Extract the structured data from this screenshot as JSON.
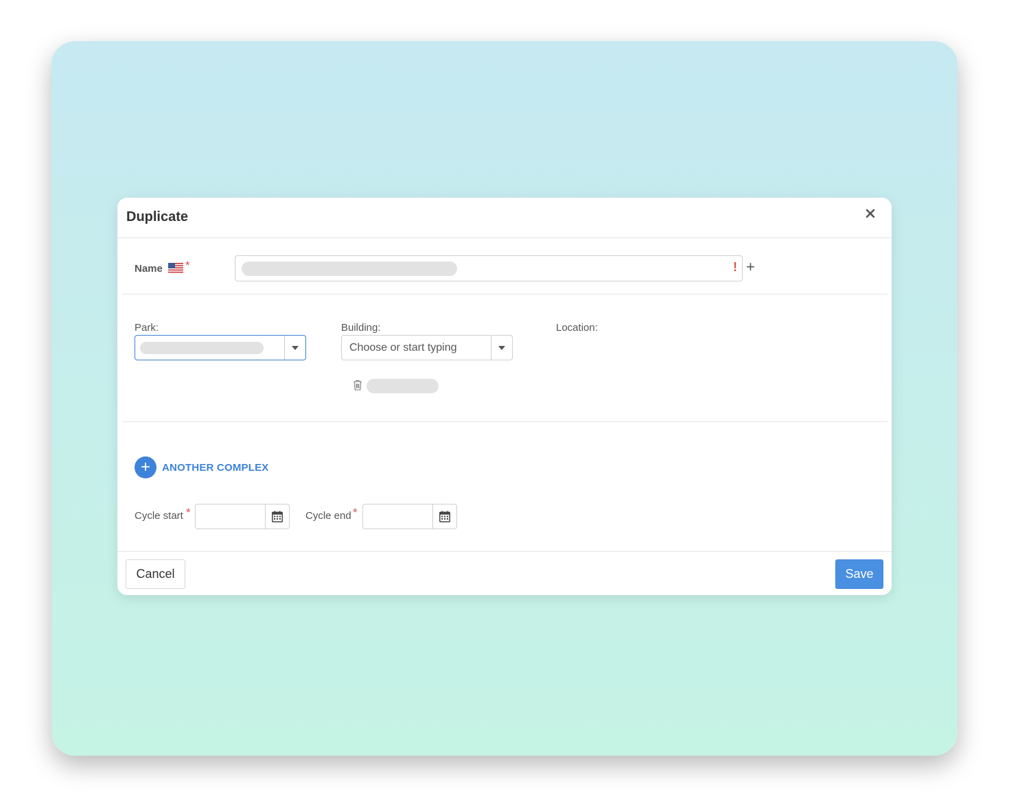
{
  "modal": {
    "title": "Duplicate",
    "close_icon": "close-icon"
  },
  "name_field": {
    "label": "Name",
    "flag_icon": "us-flag-icon",
    "required_mark": "*",
    "value_redacted": true,
    "error_mark": "!",
    "add_label": "+"
  },
  "location_section": {
    "park_label": "Park:",
    "park_value_redacted": true,
    "building_label": "Building:",
    "building_placeholder": "Choose or start typing",
    "location_label": "Location:",
    "selected_building_redacted": true
  },
  "add_complex": {
    "icon": "plus-circle-icon",
    "label": "ANOTHER COMPLEX"
  },
  "cycle": {
    "start_label": "Cycle start",
    "end_label": "Cycle end",
    "required_mark": "*",
    "start_value": "",
    "end_value": ""
  },
  "footer": {
    "cancel_label": "Cancel",
    "save_label": "Save"
  },
  "colors": {
    "accent": "#4a90e2",
    "required": "#d9534f",
    "backdrop_top": "#c6e9f2",
    "backdrop_bottom": "#c5f3e4"
  }
}
